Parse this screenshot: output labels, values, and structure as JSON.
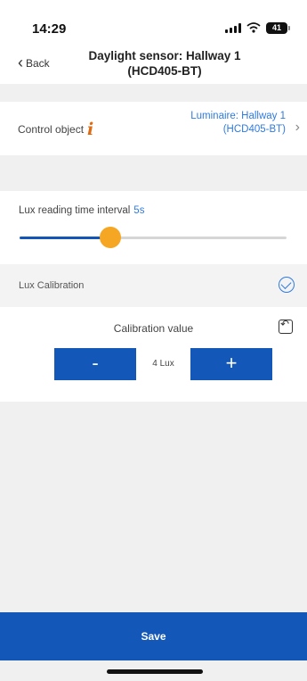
{
  "status_bar": {
    "time": "14:29",
    "battery": "41"
  },
  "nav": {
    "back_label": "Back",
    "title_line1": "Daylight sensor: Hallway 1",
    "title_line2": "(HCD405-BT)"
  },
  "control_object": {
    "label": "Control object",
    "value_line1": "Luminaire: Hallway 1",
    "value_line2": "(HCD405-BT)"
  },
  "lux_interval": {
    "label": "Lux reading time interval",
    "value": "5s",
    "slider_fraction": 0.34
  },
  "lux_calibration": {
    "label": "Lux Calibration",
    "enabled": true
  },
  "calibration": {
    "title": "Calibration value",
    "minus_label": "-",
    "plus_label": "+",
    "value": "4 Lux"
  },
  "footer": {
    "save_label": "Save"
  },
  "colors": {
    "accent": "#1358b8",
    "link": "#2f7be0",
    "slider_thumb": "#f5a623",
    "info_icon": "#e06a10"
  }
}
